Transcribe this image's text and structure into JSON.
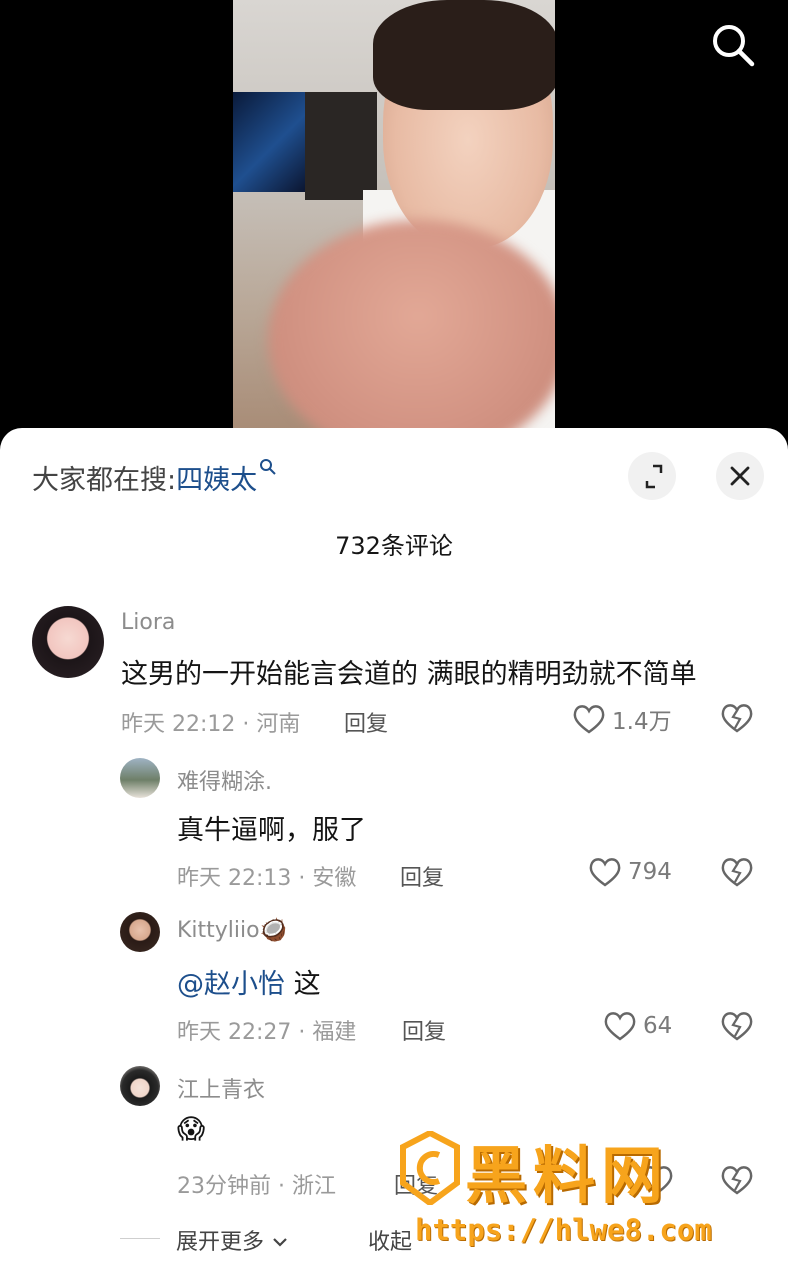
{
  "top_bar": {
    "search_icon": "search-icon"
  },
  "panel": {
    "search_prefix": "大家都在搜:",
    "search_term": "四姨太",
    "comment_count": "732条评论",
    "expand_icon": "expand-icon",
    "close_icon": "close-icon"
  },
  "comments": [
    {
      "user": "Liora",
      "text": "这男的一开始能言会道的 满眼的精明劲就不简单",
      "time": "昨天 22:12 · 河南",
      "reply": "回复",
      "likes": "1.4万"
    },
    {
      "user": "难得糊涂.",
      "text": "真牛逼啊，服了",
      "time": "昨天 22:13 · 安徽",
      "reply": "回复",
      "likes": "794"
    },
    {
      "user": "Kittyliio🥥",
      "mention": "@赵小怡",
      "text": " 这",
      "time": "昨天 22:27 · 福建",
      "reply": "回复",
      "likes": "64"
    },
    {
      "user": "江上青衣",
      "text": "😱",
      "time": "23分钟前 · 浙江",
      "reply": "回复",
      "likes": ""
    }
  ],
  "footer": {
    "expand_more": "展开更多",
    "collapse": "收起"
  },
  "watermark": {
    "title": "黑料网",
    "url": "https://hlwe8.com"
  },
  "colors": {
    "link": "#1d4f8c",
    "watermark": "#f7a41c"
  }
}
